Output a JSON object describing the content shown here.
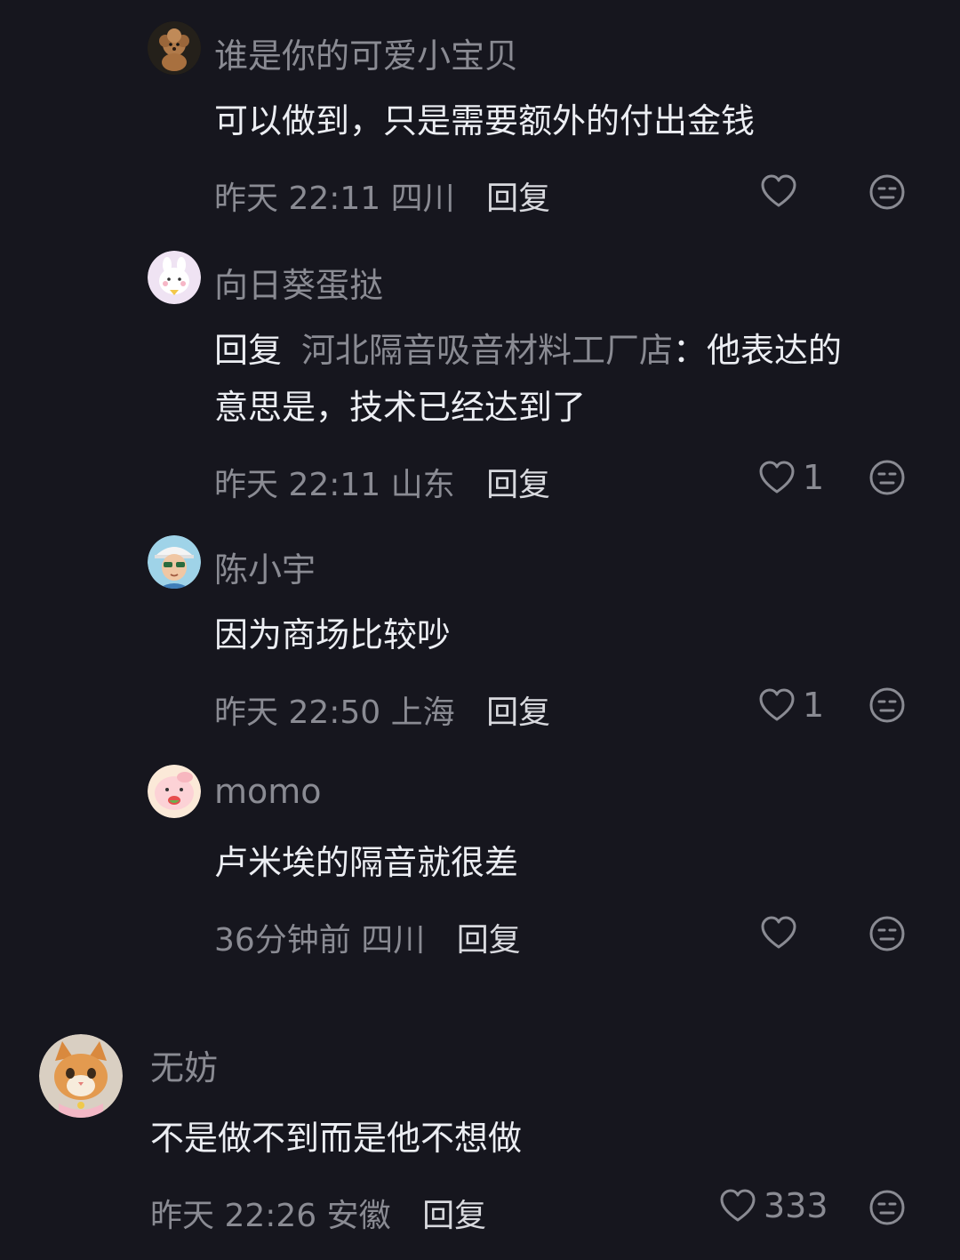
{
  "comments": [
    {
      "name": "谁是你的可爱小宝贝",
      "text": "可以做到，只是需要额外的付出金钱",
      "time": "昨天 22:11",
      "location": "四川",
      "reply_label": "回复",
      "likes": "",
      "avatar": "poodle-avatar"
    },
    {
      "name": "向日葵蛋挞",
      "reply_prefix": "回复",
      "mention": "河北隔音吸音材料工厂店",
      "text_line1_rest": "：他表达的",
      "text_line2": "意思是，技术已经达到了",
      "time": "昨天 22:11",
      "location": "山东",
      "reply_label": "回复",
      "likes": "1",
      "avatar": "cartoon-bunny-avatar"
    },
    {
      "name": "陈小宇",
      "text": "因为商场比较吵",
      "time": "昨天 22:50",
      "location": "上海",
      "reply_label": "回复",
      "likes": "1",
      "avatar": "boy-cap-avatar"
    },
    {
      "name": "momo",
      "text": "卢米埃的隔音就很差",
      "time": "36分钟前",
      "location": "四川",
      "reply_label": "回复",
      "likes": "",
      "avatar": "pink-piglet-avatar"
    },
    {
      "name": "无妨",
      "text": "不是做不到而是他不想做",
      "time": "昨天 22:26",
      "location": "安徽",
      "reply_label": "回复",
      "likes": "333",
      "avatar": "orange-cat-avatar"
    }
  ],
  "colors": {
    "background": "#16161e",
    "primary_text": "#eceef3",
    "secondary_text": "#8a8b93"
  }
}
